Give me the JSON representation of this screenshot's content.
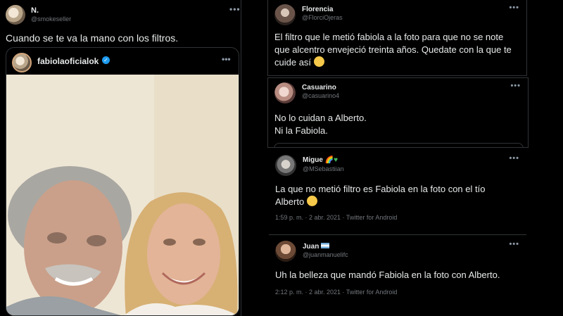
{
  "left_tweet": {
    "author_name": "N.",
    "author_handle": "@smokeseller",
    "more": "•••",
    "text": "Cuando se te va la mano con los filtros.",
    "embed": {
      "author_name": "fabiolaoficialok",
      "more": "•••",
      "verified_icon": "verified-badge-icon"
    }
  },
  "replies": [
    {
      "author_name": "Florencia",
      "author_handle": "@FlorciOjeras",
      "more": "•••",
      "text": "El filtro que le metió fabiola a la foto para que no se note que alcentro envejeció treinta años. Quedate con la que te cuide así",
      "emoji": "smiling-face-emoji"
    },
    {
      "author_name": "Casuarino",
      "author_handle": "@casuarino4",
      "more": "•••",
      "text": "No lo cuidan a Alberto.\nNi la Fabiola."
    },
    {
      "author_name": "Migue",
      "author_handle": "@MSebastiian",
      "more": "•••",
      "text": "La que no metió filtro es Fabiola en la foto con el tío Alberto",
      "emoji": "laughing-face-emoji",
      "meta": "1:59 p. m. · 2 abr. 2021 · Twitter for Android"
    },
    {
      "author_name": "Juan",
      "author_handle": "@juanmanuelifc",
      "more": "•••",
      "text": "Uh la belleza que mandó Fabiola en la foto con Alberto.",
      "meta": "2:12 p. m. · 2 abr. 2021 · Twitter for Android"
    }
  ],
  "colors": {
    "background": "#000000",
    "text": "#e7e9ea",
    "muted": "#71767b",
    "border": "#2f3336",
    "verified": "#1d9bf0"
  }
}
